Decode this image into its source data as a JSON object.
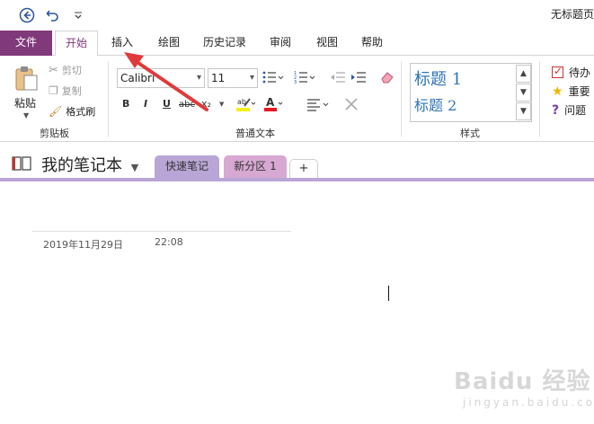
{
  "title_bar": {
    "doc_title": "无标题页"
  },
  "tabs": [
    {
      "label": "文件"
    },
    {
      "label": "开始"
    },
    {
      "label": "插入"
    },
    {
      "label": "绘图"
    },
    {
      "label": "历史记录"
    },
    {
      "label": "审阅"
    },
    {
      "label": "视图"
    },
    {
      "label": "帮助"
    }
  ],
  "clipboard": {
    "paste": "粘贴",
    "cut": "剪切",
    "copy": "复制",
    "format_painter": "格式刷",
    "group_label": "剪贴板"
  },
  "basic_text": {
    "font_name": "Calibri",
    "font_size": "11",
    "bold": "B",
    "italic": "I",
    "underline": "U",
    "strike": "abc",
    "subscript": "x₂",
    "group_label": "普通文本"
  },
  "styles": {
    "heading1": "标题 1",
    "heading2": "标题 2",
    "group_label": "样式"
  },
  "tags": {
    "todo": "待办",
    "important": "重要",
    "question": "问题"
  },
  "notebook": {
    "name": "我的笔记本",
    "sections": [
      {
        "label": "快速笔记",
        "color": "#b9a6d6"
      },
      {
        "label": "新分区 1",
        "color": "#d7a8d2"
      }
    ],
    "add_label": "+"
  },
  "page": {
    "date": "2019年11月29日",
    "time": "22:08"
  },
  "watermark": {
    "text": "Baidu 经验",
    "sub": "jingyan.baidu.com"
  },
  "colors": {
    "accent": "#80397b",
    "arrow": "#e03a3a"
  }
}
